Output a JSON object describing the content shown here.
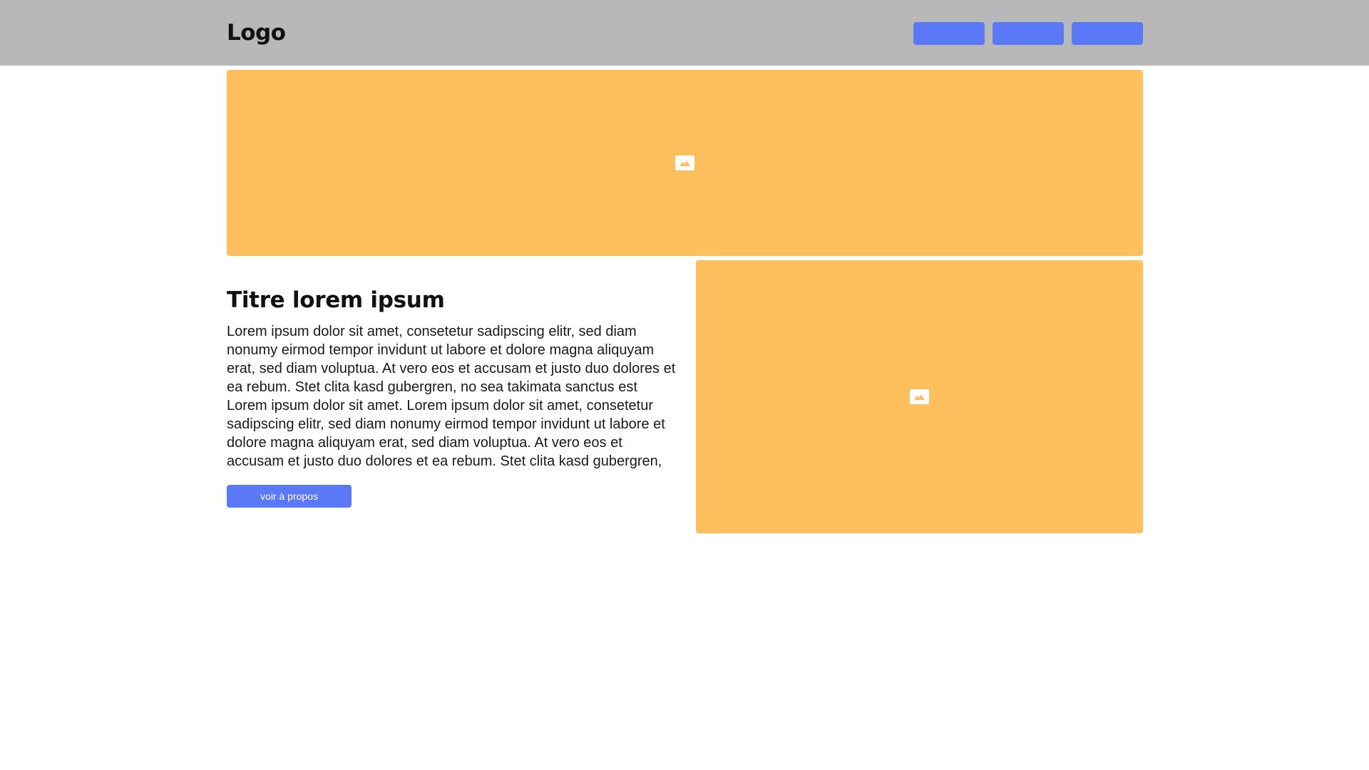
{
  "header": {
    "logo": "Logo",
    "nav_buttons": [
      "",
      "",
      ""
    ]
  },
  "section": {
    "title": "Titre lorem ipsum",
    "body": "Lorem ipsum dolor sit amet, consetetur sadipscing elitr, sed diam nonumy eirmod tempor invidunt ut labore et dolore magna aliquyam erat, sed diam voluptua. At vero eos et accusam et justo duo dolores et ea rebum. Stet clita kasd gubergren, no sea takimata sanctus est Lorem ipsum dolor sit amet. Lorem ipsum dolor sit amet, consetetur sadipscing elitr, sed diam nonumy eirmod tempor invidunt ut labore et dolore magna aliquyam erat, sed diam voluptua. At vero eos et accusam et justo duo dolores et ea rebum. Stet clita kasd gubergren,",
    "cta_label": "voir à propos"
  },
  "icons": {
    "image_placeholder": "image-placeholder-icon"
  },
  "colors": {
    "header_bg": "#b8b8b8",
    "button": "#5b78f6",
    "placeholder": "#ffbf5c",
    "text": "#111111"
  }
}
